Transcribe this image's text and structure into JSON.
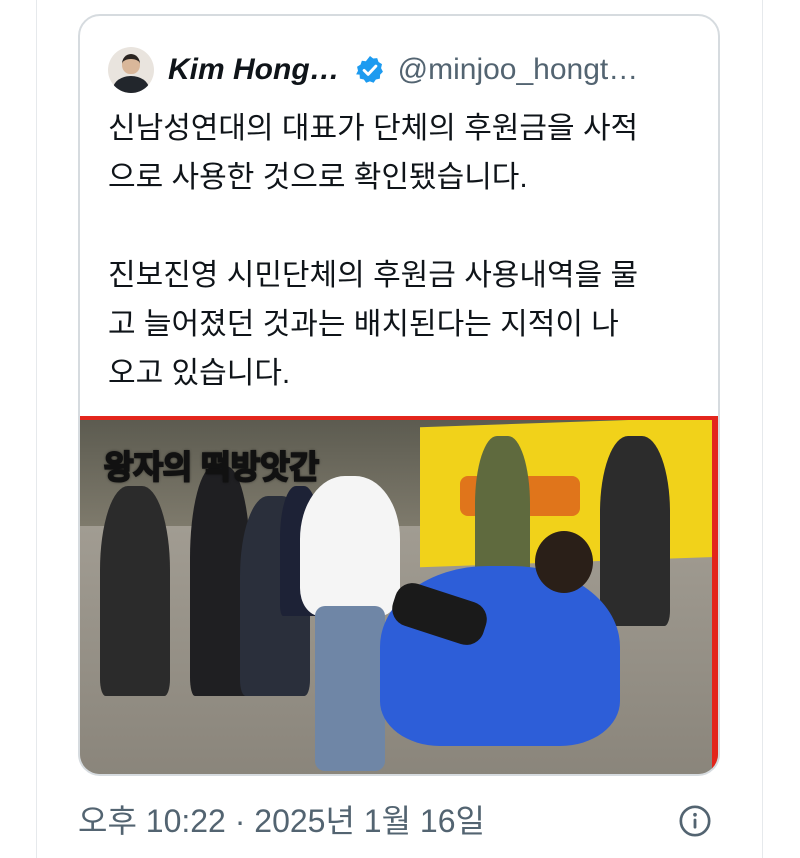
{
  "quote": {
    "author_name": "Kim Hong…",
    "handle": "@minjoo_hongt…",
    "text": "신남성연대의 대표가 단체의 후원금을 사적\n으로 사용한 것으로 확인됐습니다.\n\n진보진영 시민단체의 후원금 사용내역을 물\n고 늘어졌던 것과는 배치된다는 지적이 나\n오고 있습니다.",
    "media_caption": "왕자의 떡방앗간"
  },
  "meta": {
    "timestamp": "오후 10:22 · 2025년 1월 16일"
  },
  "icons": {
    "verified": "verified-badge-icon",
    "info": "info-icon"
  },
  "colors": {
    "verified_blue": "#1d9bf0",
    "secondary_text": "#536471",
    "primary_text": "#0f1419",
    "card_border": "#d6dbdf"
  }
}
